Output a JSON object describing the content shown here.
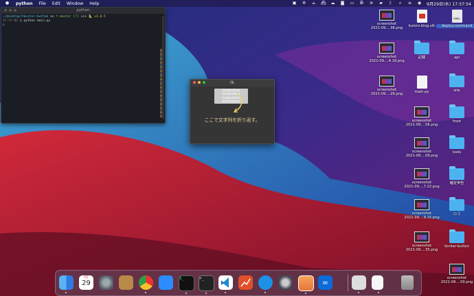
{
  "menubar": {
    "app_name": "python",
    "menus": [
      "File",
      "Edit",
      "Window",
      "Help"
    ],
    "clock": "9月29日(水) 17:37:54"
  },
  "terminal": {
    "title": "python",
    "prompt_path": "~/desktop/tkniter-button",
    "prompt_on": "on",
    "branch": "master [?]",
    "via": "via",
    "pyversion": "v3.8.5",
    "time": "17:37:02",
    "command": "❯ python main.py",
    "cursor": "▯"
  },
  "tk_window": {
    "title": "tk",
    "button_lines": [
      "tonbutton",
      "buttonbut",
      "tonbutton",
      "buttonbut"
    ],
    "caption": "ここで文字列を折り返す。"
  },
  "desktop_icons": [
    {
      "label": "screenshot\n2021-09....38.png",
      "type": "shot"
    },
    {
      "label": "kuroro.blog.xlk",
      "type": "pdf"
    },
    {
      "label": "deploy.command",
      "type": "command"
    },
    {
      "label": "screenshot\n2021-09....4.18.png",
      "type": "shot"
    },
    {
      "label": "記録",
      "type": "folder"
    },
    {
      "label": "api",
      "type": "folder"
    },
    {
      "label": "screenshot\n2021-09....29.png",
      "type": "shot"
    },
    {
      "label": "main.py",
      "type": "doc"
    },
    {
      "label": "site",
      "type": "folder"
    },
    {
      "label": "screenshot\n2021-09....56.png",
      "type": "shot"
    },
    {
      "label": "front",
      "type": "folder"
    },
    {
      "label": "screenshot\n2021-09....09.png",
      "type": "shot"
    },
    {
      "label": "tools",
      "type": "folder"
    },
    {
      "label": "screenshot\n2021-09....7.22.png",
      "type": "shot"
    },
    {
      "label": "確定申告",
      "type": "folder"
    },
    {
      "label": "screenshot\n2021-09....9.15.png",
      "type": "shot"
    },
    {
      "label": "ロゴ",
      "type": "folder"
    },
    {
      "label": "screenshot\n2021-09....35.png",
      "type": "shot"
    },
    {
      "label": "tkniter-button",
      "type": "folder"
    },
    {
      "label": "screenshot\n2021-09....00.png",
      "type": "shot"
    }
  ],
  "dock": {
    "calendar_month": "9月",
    "calendar_day": "29",
    "apps": [
      "finder",
      "calendar",
      "system-preferences",
      "contacts",
      "chrome",
      "zoom",
      "terminal-iterm",
      "terminal",
      "vscode",
      "git-app",
      "docker",
      "quicktime",
      "preview-photo",
      "infinity-app",
      "preview",
      "document",
      "trash"
    ]
  }
}
